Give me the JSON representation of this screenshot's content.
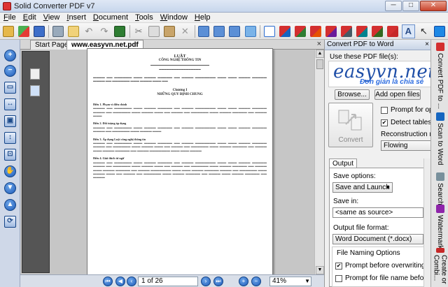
{
  "window": {
    "title": "Solid Converter PDF v7",
    "min": "─",
    "max": "□",
    "close": "✕"
  },
  "menu": [
    "File",
    "Edit",
    "View",
    "Insert",
    "Document",
    "Tools",
    "Window",
    "Help"
  ],
  "tabs": {
    "start": "Start Page",
    "doc": "www.easyvn.net.pdf",
    "close": "×"
  },
  "nav": {
    "page": "1 of 26",
    "zoom": "41%"
  },
  "document": {
    "title": "LUẬT",
    "subtitle": "CÔNG NGHỆ THÔNG TIN",
    "chapter": "Chương I",
    "chapter_title": "NHỮNG QUY ĐỊNH CHUNG",
    "articles": [
      "Điều 1. Phạm vi điều chỉnh",
      "Điều 2. Đối tượng áp dụng",
      "Điều 3. Áp dụng Luật công nghệ thông tin",
      "Điều 4. Giải thích từ ngữ"
    ]
  },
  "panel": {
    "header": "Convert PDF to Word",
    "close": "×",
    "use_files": "Use these PDF file(s):",
    "logo_text": "easyvn.net",
    "logo_tagline": "Đơn giản là chia sẻ",
    "browse": "Browse...",
    "add_open": "Add open files",
    "convert": "Convert",
    "prompt_options": "Prompt for options",
    "detect_tables": "Detect tables",
    "reconstruction": "Reconstruction mode:",
    "reconstruction_value": "Flowing",
    "output_tab": "Output",
    "save_options": "Save options:",
    "save_value": "Save and Launch",
    "save_in": "Save in:",
    "save_in_value": "<same as source>",
    "format_label": "Output file format:",
    "format_value": "Word Document (*.docx)",
    "naming": "File Naming Options",
    "overwrite": "Prompt before overwriting",
    "prompt_name": "Prompt for file name before saving"
  },
  "sidetabs": [
    "Convert PDF to ...",
    "Scan to Word",
    "Search",
    "Watermarks",
    "Create or Combi..."
  ]
}
